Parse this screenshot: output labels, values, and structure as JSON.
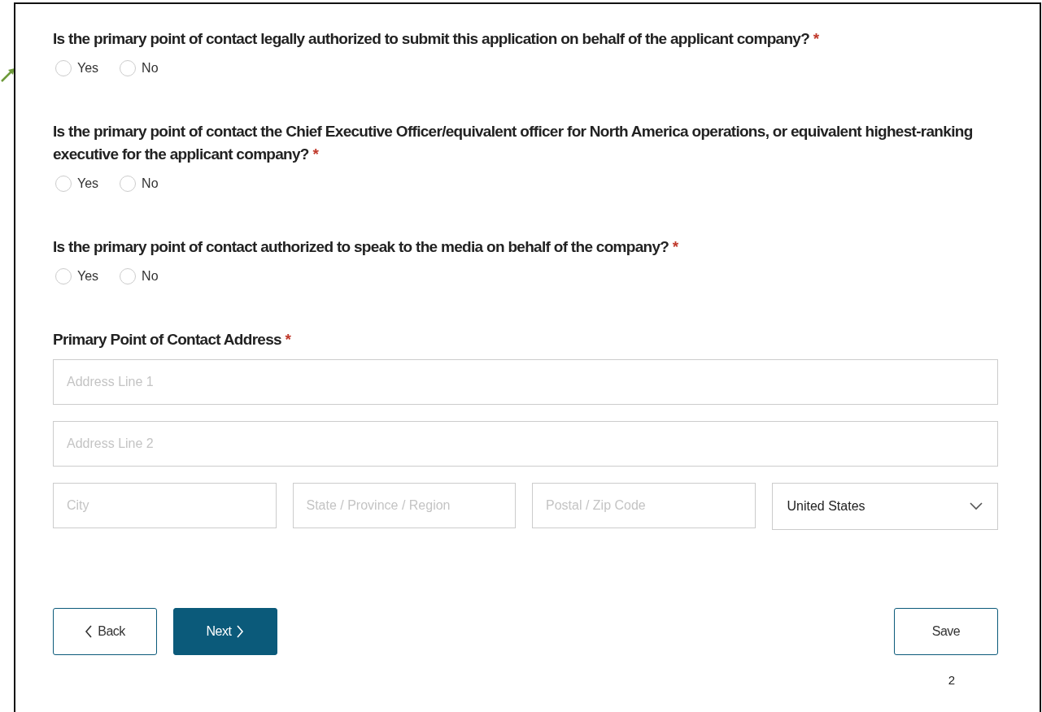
{
  "questions": [
    {
      "text": "Is the primary point of contact legally authorized to submit this application on behalf of the applicant company?",
      "required_mark": "*",
      "options": [
        {
          "label": "Yes",
          "selected": false
        },
        {
          "label": "No",
          "selected": false
        }
      ]
    },
    {
      "text": "Is the primary point of contact the Chief Executive Officer/equivalent officer for North America operations, or equivalent highest-ranking executive for the applicant company?",
      "required_mark": "*",
      "options": [
        {
          "label": "Yes",
          "selected": false
        },
        {
          "label": "No",
          "selected": false
        }
      ]
    },
    {
      "text": "Is the primary point of contact authorized to speak to the media on behalf of the company?",
      "required_mark": "*",
      "options": [
        {
          "label": "Yes",
          "selected": false
        },
        {
          "label": "No",
          "selected": false
        }
      ]
    }
  ],
  "address": {
    "label": "Primary Point of Contact Address",
    "required_mark": "*",
    "line1": {
      "placeholder": "Address Line 1"
    },
    "line2": {
      "placeholder": "Address Line 2"
    },
    "city": {
      "placeholder": "City"
    },
    "state": {
      "placeholder": "State / Province / Region"
    },
    "postal": {
      "placeholder": "Postal / Zip Code"
    },
    "country": {
      "value": "United States"
    }
  },
  "buttons": {
    "back": "Back",
    "next": "Next",
    "save": "Save"
  },
  "page_number": "2"
}
